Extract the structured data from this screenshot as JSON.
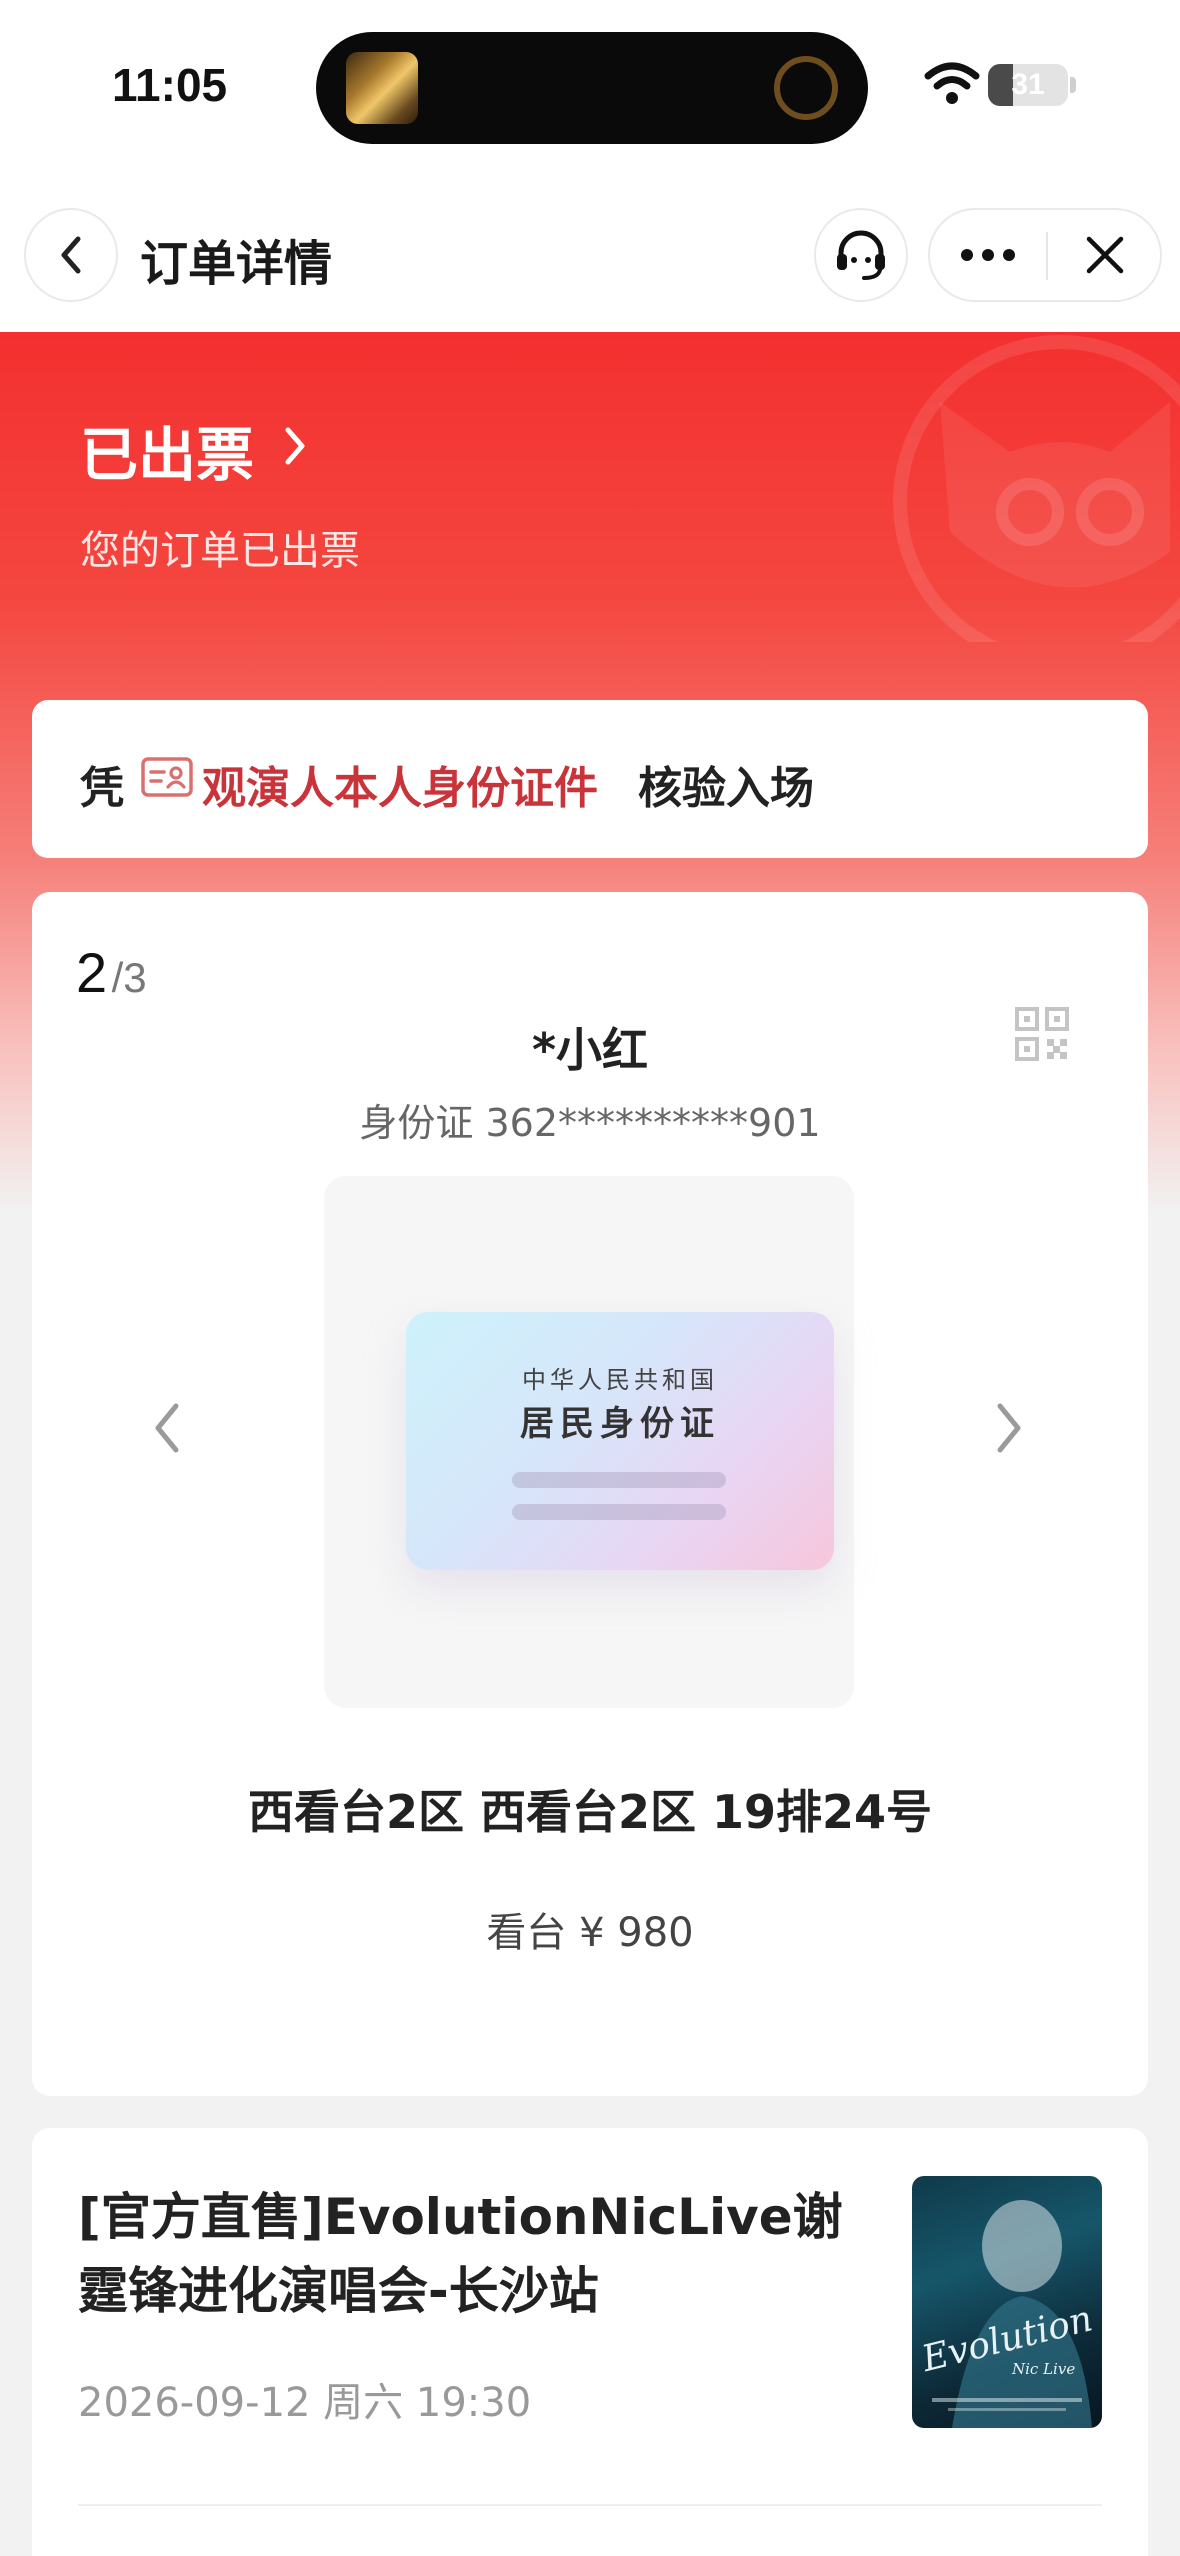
{
  "status_bar": {
    "time": "11:05",
    "battery": "31",
    "battery_level": 0.31
  },
  "nav": {
    "title": "订单详情"
  },
  "header": {
    "status": "已出票",
    "subtitle": "您的订单已出票"
  },
  "notice": {
    "prefix": "凭",
    "highlight": "观演人本人身份证件",
    "suffix": "核验入场",
    "icon": "id-card-icon"
  },
  "ticket": {
    "page_current": "2",
    "page_total": "/3",
    "holder_name": "*小红",
    "holder_id": "身份证 362**********901",
    "id_card_top": "中华人民共和国",
    "id_card_title": "居民身份证",
    "seat": "西看台2区 西看台2区 19排24号",
    "price": "看台 ¥ 980"
  },
  "show": {
    "title": "[官方直售]EvolutionNicLive谢霆锋进化演唱会-长沙站",
    "time": "2026-09-12 周六 19:30",
    "poster_text": "Evolution",
    "poster_sub": "Nic Live"
  },
  "colors": {
    "accent_red": "#f3302f",
    "highlight_red": "#c8343a"
  }
}
